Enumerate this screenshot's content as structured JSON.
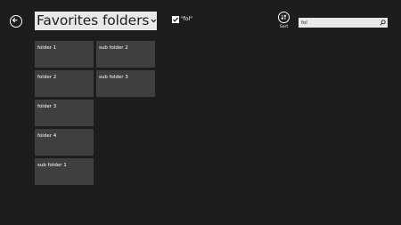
{
  "header": {
    "title": "Favorites folders",
    "title_dropdown_icon": "chevron-down-icon",
    "back_icon": "arrow-left-icon"
  },
  "filter": {
    "checked": true,
    "label": "\"fol\""
  },
  "sort": {
    "icon": "sort-icon",
    "label": "Sort"
  },
  "search": {
    "value": "fol",
    "icon": "search-icon"
  },
  "tiles": {
    "folder_1": "folder 1",
    "folder_2": "folder 2",
    "folder_3": "folder 3",
    "folder_4": "folder 4",
    "sub_folder_1": "sub folder 1",
    "sub_folder_2": "sub folder 2",
    "sub_folder_3": "sub folder 3"
  },
  "colors": {
    "background": "#1d1d1d",
    "tile": "#3f3f3f",
    "title_box": "#e8e8e8",
    "search_box": "#e8e8e8",
    "text": "#ffffff"
  }
}
